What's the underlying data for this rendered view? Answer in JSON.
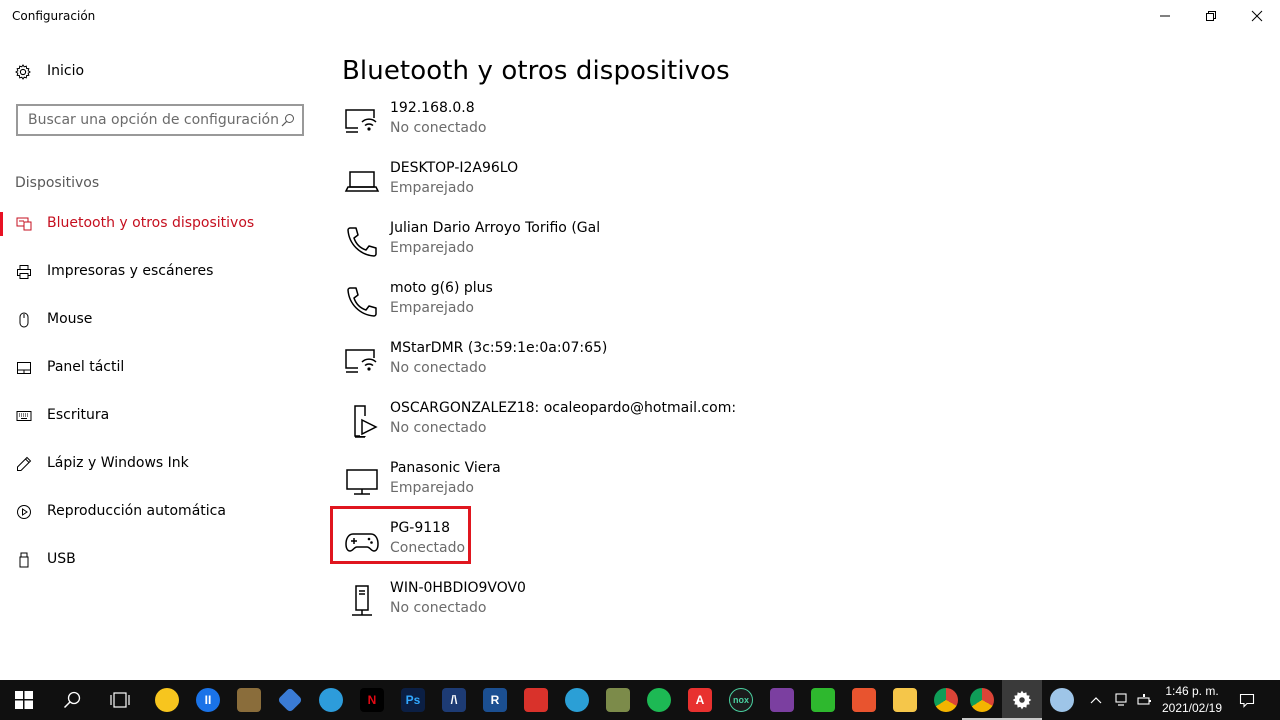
{
  "window": {
    "title": "Configuración"
  },
  "sidebar": {
    "home_label": "Inicio",
    "search_placeholder": "Buscar una opción de configuración",
    "section_title": "Dispositivos",
    "items": [
      {
        "label": "Bluetooth y otros dispositivos",
        "icon": "bluetooth-devices-icon",
        "selected": true
      },
      {
        "label": "Impresoras y escáneres",
        "icon": "printer-icon",
        "selected": false
      },
      {
        "label": "Mouse",
        "icon": "mouse-icon",
        "selected": false
      },
      {
        "label": "Panel táctil",
        "icon": "touchpad-icon",
        "selected": false
      },
      {
        "label": "Escritura",
        "icon": "keyboard-icon",
        "selected": false
      },
      {
        "label": "Lápiz y Windows Ink",
        "icon": "pen-icon",
        "selected": false
      },
      {
        "label": "Reproducción automática",
        "icon": "autoplay-icon",
        "selected": false
      },
      {
        "label": "USB",
        "icon": "usb-icon",
        "selected": false
      }
    ]
  },
  "main": {
    "title": "Bluetooth y otros dispositivos",
    "devices": [
      {
        "name": "192.168.0.8",
        "status": "No conectado",
        "icon": "media-device-icon"
      },
      {
        "name": "DESKTOP-I2A96LO",
        "status": "Emparejado",
        "icon": "laptop-icon"
      },
      {
        "name": "Julian Dario Arroyo Torifio (Gal",
        "status": "Emparejado",
        "icon": "phone-icon"
      },
      {
        "name": "moto g(6) plus",
        "status": "Emparejado",
        "icon": "phone-icon"
      },
      {
        "name": "MStarDMR (3c:59:1e:0a:07:65)",
        "status": "No conectado",
        "icon": "media-device-icon"
      },
      {
        "name": "OSCARGONZALEZ18: ocaleopardo@hotmail.com:",
        "status": "No conectado",
        "icon": "media-player-icon"
      },
      {
        "name": "Panasonic Viera",
        "status": "Emparejado",
        "icon": "tv-icon"
      },
      {
        "name": "PG-9118",
        "status": "Conectado",
        "icon": "gamepad-icon",
        "highlighted": true
      },
      {
        "name": "WIN-0HBDIO9VOV0",
        "status": "No conectado",
        "icon": "tower-pc-icon"
      }
    ]
  },
  "taskbar": {
    "apps": [
      {
        "name": "osu",
        "letter": "",
        "color": "#f7c51e"
      },
      {
        "name": "pause-app",
        "letter": "II",
        "color": "#1a73e8"
      },
      {
        "name": "game",
        "letter": "",
        "color": "#8a6d3b"
      },
      {
        "name": "app-blue",
        "letter": "",
        "color": "#3a7bd5"
      },
      {
        "name": "web-app",
        "letter": "",
        "color": "#2d9cdb"
      },
      {
        "name": "netflix",
        "letter": "N",
        "color": "#000000"
      },
      {
        "name": "photoshop",
        "letter": "Ps",
        "color": "#0b1f44"
      },
      {
        "name": "archicad",
        "letter": "/\\",
        "color": "#1d3b74"
      },
      {
        "name": "revit",
        "letter": "R",
        "color": "#1b4f91"
      },
      {
        "name": "sketchup",
        "letter": "",
        "color": "#d9322b"
      },
      {
        "name": "search-app",
        "letter": "",
        "color": "#2b9fd6"
      },
      {
        "name": "tool-app",
        "letter": "",
        "color": "#7c8b4a"
      },
      {
        "name": "spotify",
        "letter": "",
        "color": "#1db954"
      },
      {
        "name": "autocad",
        "letter": "A",
        "color": "#e8312f"
      },
      {
        "name": "nox",
        "letter": "nox",
        "color": "#1b1b1b"
      },
      {
        "name": "winrar",
        "letter": "",
        "color": "#7b3fa0"
      },
      {
        "name": "line-app",
        "letter": "",
        "color": "#2eb82e"
      },
      {
        "name": "pdf-app",
        "letter": "",
        "color": "#e8542f"
      },
      {
        "name": "file-explorer",
        "letter": "",
        "color": "#f5c64a"
      },
      {
        "name": "chrome",
        "letter": "",
        "color": "#4285f4"
      },
      {
        "name": "chrome-2",
        "letter": "",
        "color": "#4285f4"
      }
    ],
    "time": "1:46 p. m.",
    "date": "2021/02/19"
  }
}
